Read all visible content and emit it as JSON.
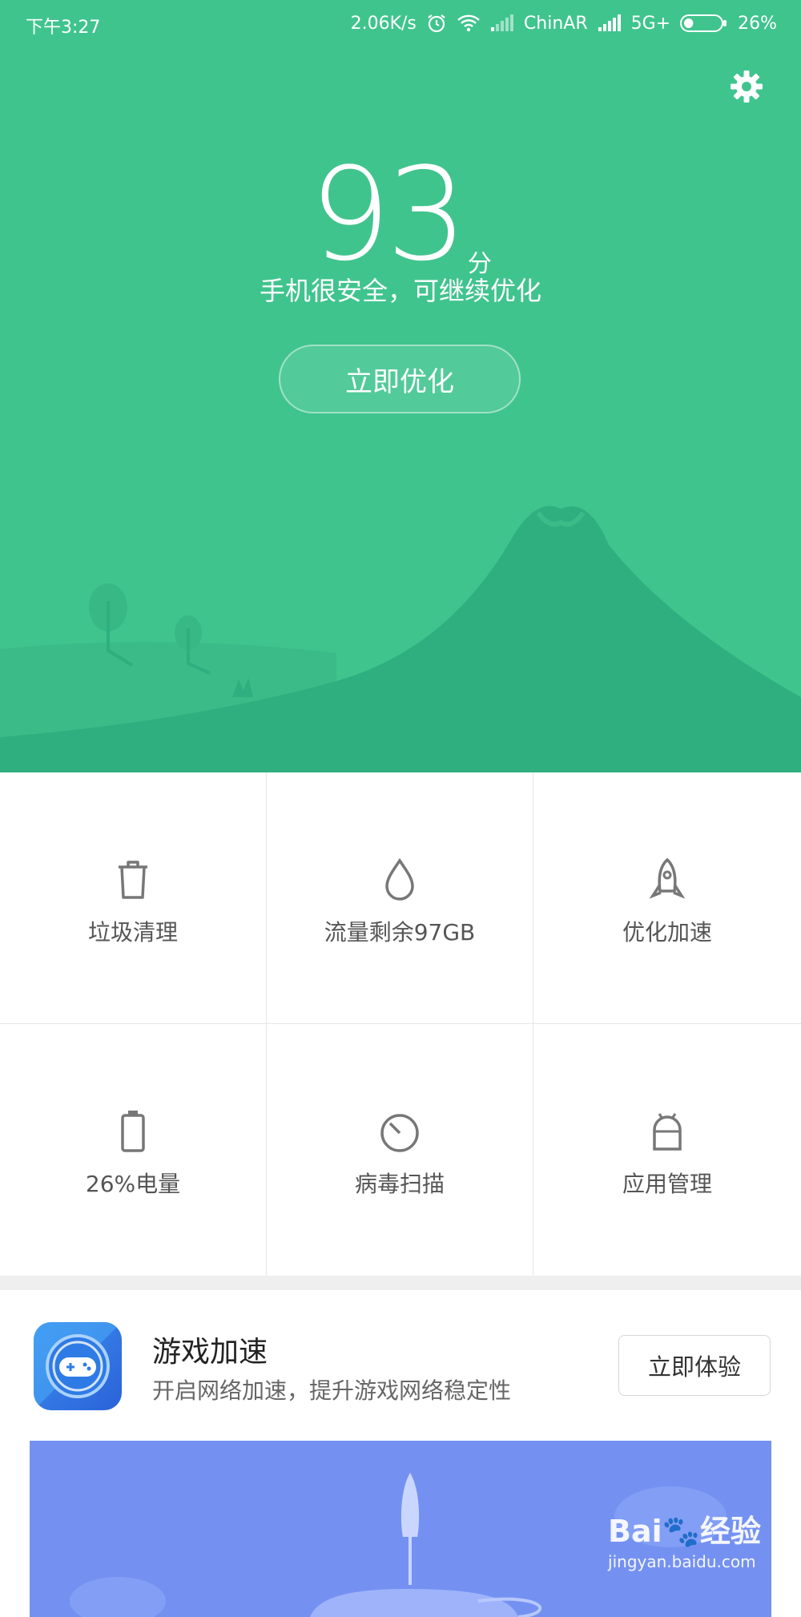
{
  "status_bar": {
    "time": "下午3:27",
    "net_speed": "2.06K/s",
    "carrier": "ChinAR",
    "network": "5G+",
    "battery": "26%",
    "battery_level": 0.26
  },
  "hero": {
    "score": "93",
    "score_unit": "分",
    "subtitle": "手机很安全，可继续优化",
    "optimize_button": "立即优化",
    "bg_color": "#40c48e"
  },
  "tools": [
    {
      "label": "垃圾清理",
      "icon": "trash-icon"
    },
    {
      "label": "流量剩余97GB",
      "icon": "droplet-icon"
    },
    {
      "label": "优化加速",
      "icon": "rocket-icon"
    },
    {
      "label": "26%电量",
      "icon": "battery-icon"
    },
    {
      "label": "病毒扫描",
      "icon": "scan-icon"
    },
    {
      "label": "应用管理",
      "icon": "android-icon"
    }
  ],
  "promo": {
    "title": "游戏加速",
    "description": "开启网络加速，提升游戏网络稳定性",
    "button": "立即体验",
    "icon": "gamepad-icon"
  },
  "watermark": {
    "brand": "Bai🐾经验",
    "url": "jingyan.baidu.com"
  }
}
